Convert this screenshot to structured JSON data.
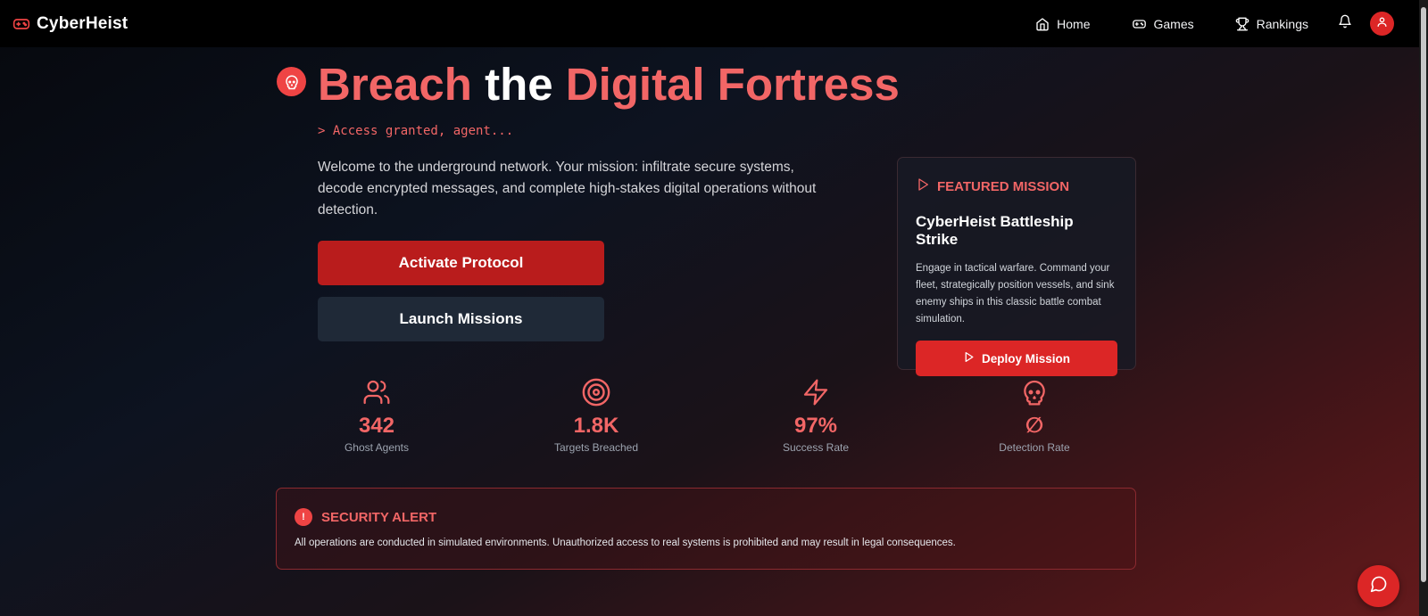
{
  "nav": {
    "brand": "CyberHeist",
    "links": [
      {
        "label": "Home",
        "icon": "home-icon"
      },
      {
        "label": "Games",
        "icon": "gamepad-icon"
      },
      {
        "label": "Rankings",
        "icon": "trophy-icon"
      }
    ]
  },
  "hero": {
    "title_part1": "Breach",
    "title_part2": "the",
    "title_part3": "Digital Fortress",
    "terminal": "> Access granted, agent...",
    "intro": "Welcome to the underground network. Your mission: infiltrate secure systems, decode encrypted messages, and complete high-stakes digital operations without detection.",
    "primary_button": "Activate Protocol",
    "secondary_button": "Launch Missions"
  },
  "featured": {
    "label": "FEATURED MISSION",
    "title": "CyberHeist Battleship Strike",
    "description": "Engage in tactical warfare. Command your fleet, strategically position vessels, and sink enemy ships in this classic battle combat simulation.",
    "button": "Deploy Mission"
  },
  "stats": [
    {
      "value": "342",
      "label": "Ghost Agents",
      "icon": "users-icon"
    },
    {
      "value": "1.8K",
      "label": "Targets Breached",
      "icon": "target-icon"
    },
    {
      "value": "97%",
      "label": "Success Rate",
      "icon": "lightning-icon"
    },
    {
      "value": "∅",
      "label": "Detection Rate",
      "icon": "skull-icon"
    }
  ],
  "alert": {
    "title": "SECURITY ALERT",
    "text": "All operations are conducted in simulated environments. Unauthorized access to real systems is prohibited and may result in legal consequences."
  },
  "colors": {
    "accent": "#f26666",
    "primary_button": "#b91c1c",
    "deploy_button": "#dc2626",
    "secondary_button": "#1f2937"
  }
}
